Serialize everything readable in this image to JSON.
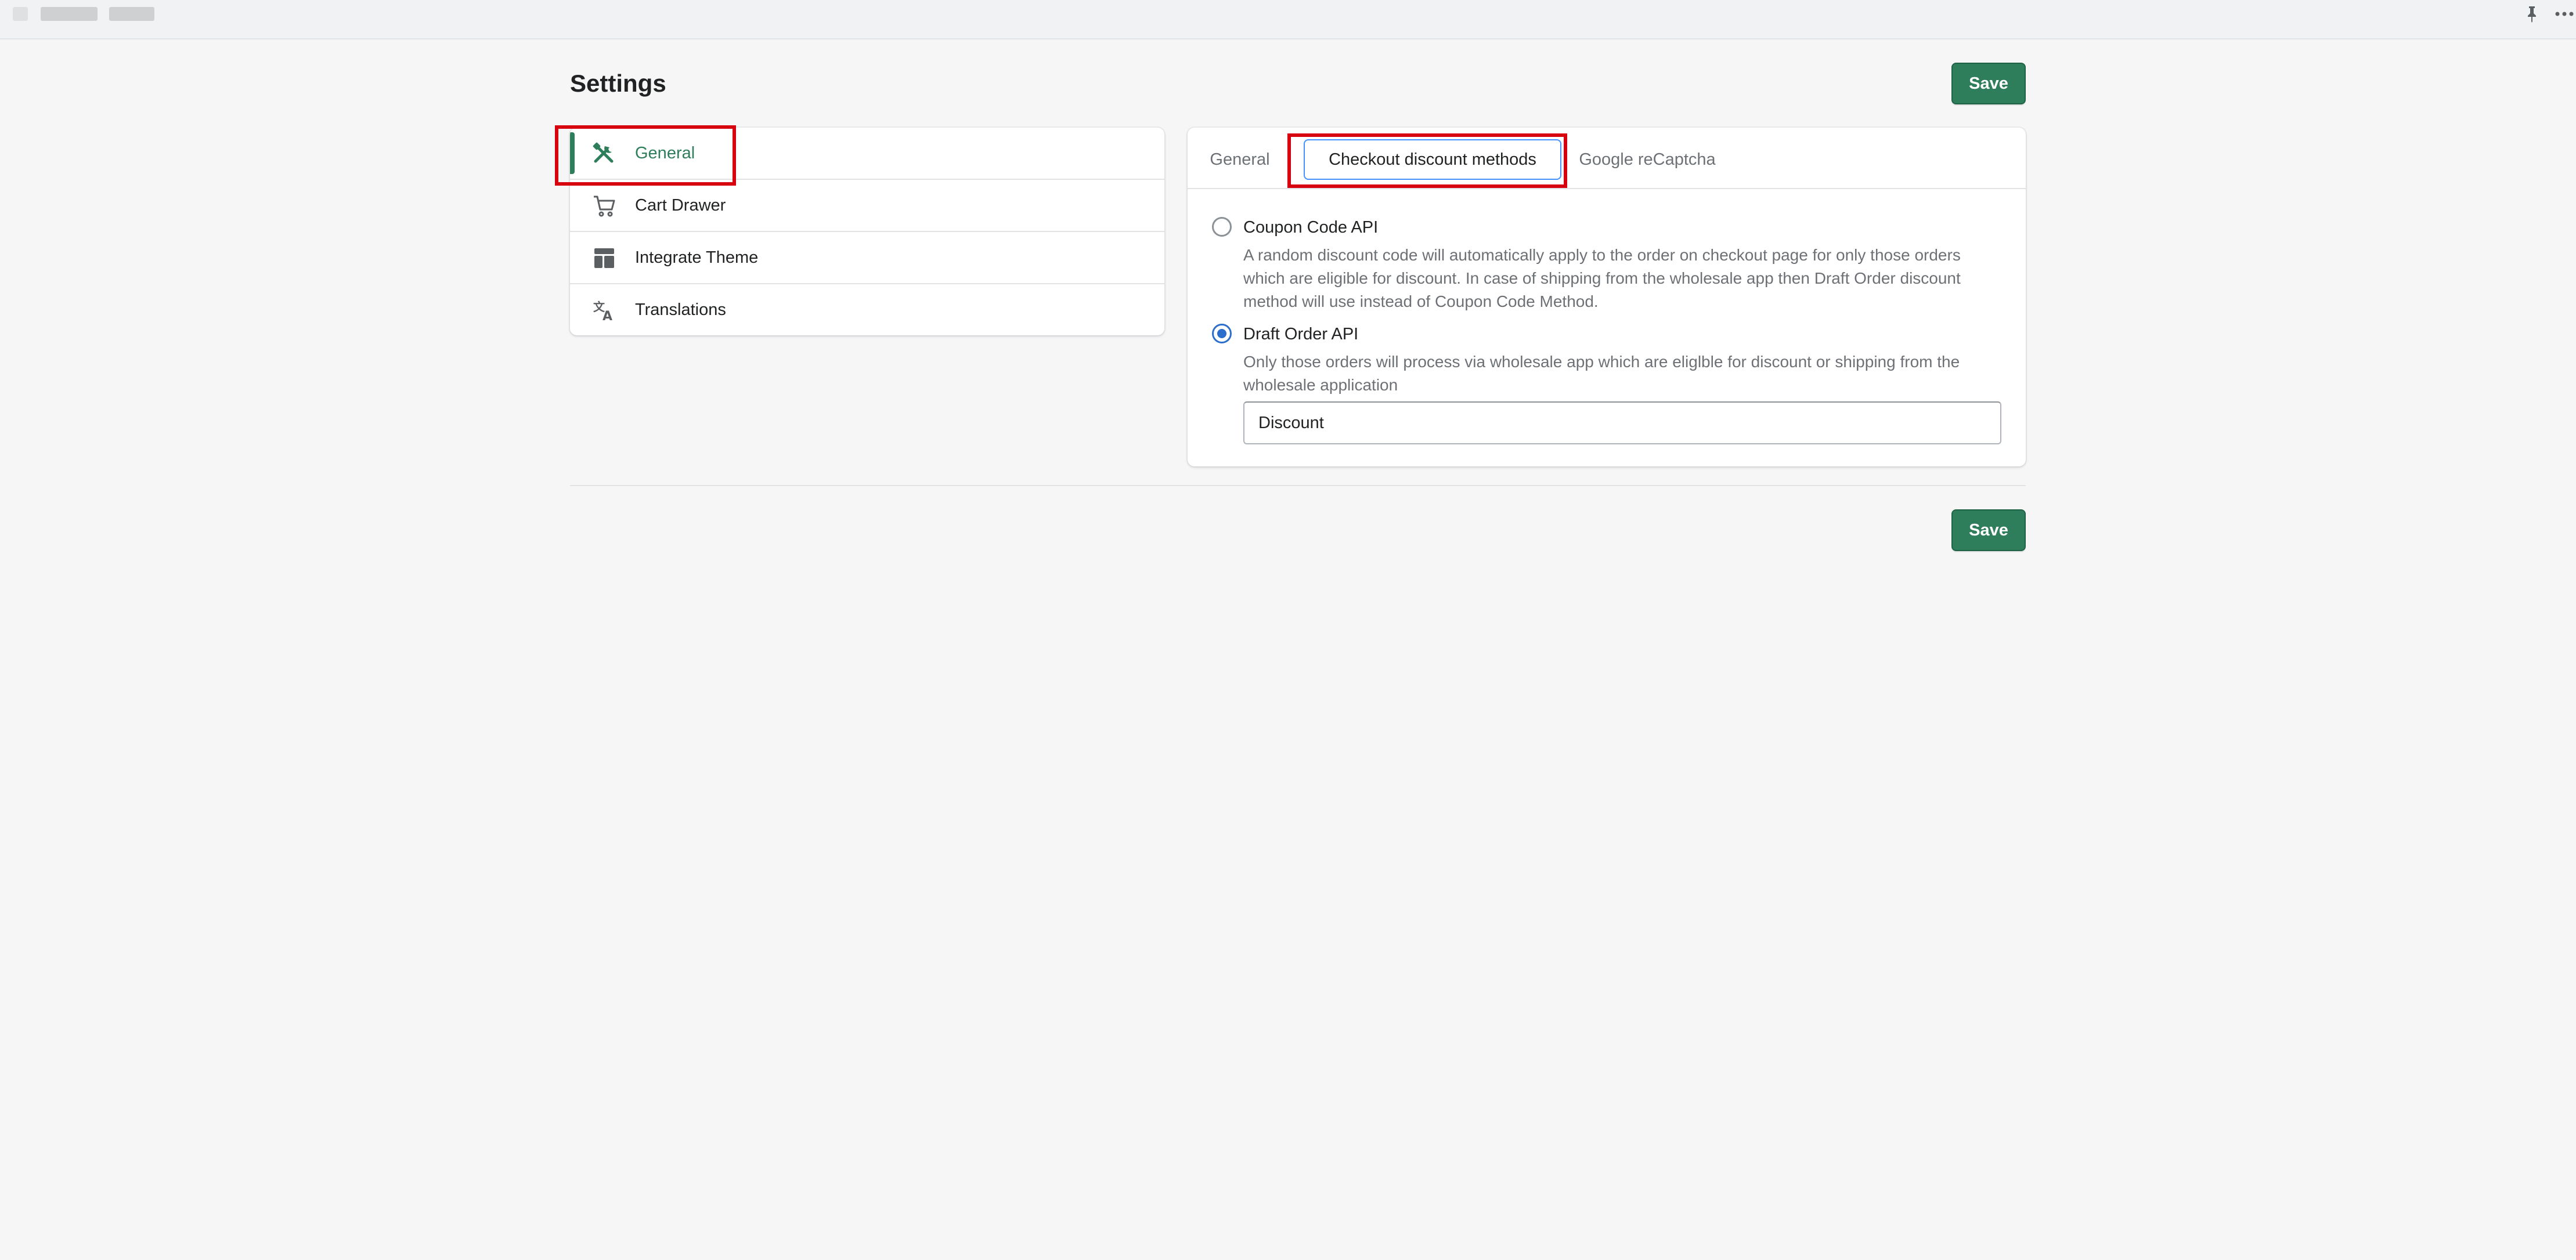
{
  "topbar": {
    "pin_icon": "pin-icon",
    "more_icon": "more-horizontal-icon"
  },
  "page": {
    "title": "Settings",
    "save_label": "Save",
    "save_bottom_label": "Save"
  },
  "nav": {
    "items": [
      {
        "label": "General",
        "icon": "tools-icon",
        "active": true
      },
      {
        "label": "Cart Drawer",
        "icon": "cart-icon",
        "active": false
      },
      {
        "label": "Integrate Theme",
        "icon": "layout-icon",
        "active": false
      },
      {
        "label": "Translations",
        "icon": "translate-icon",
        "active": false
      }
    ]
  },
  "tabs": {
    "items": [
      {
        "label": "General"
      },
      {
        "label": "Checkout discount methods",
        "selected": true
      },
      {
        "label": "Google reCaptcha"
      }
    ]
  },
  "options": {
    "coupon": {
      "label": "Coupon Code API",
      "help_lines": [
        "A random discount code will automatically apply to the order on checkout page for only those orders",
        "which are eligible for discount. In case of shipping from the wholesale app then Draft Order discount",
        "method will use instead of Coupon Code Method."
      ],
      "checked": false
    },
    "draft": {
      "label": "Draft Order API",
      "help_lines": [
        "Only those orders will process via wholesale app which are eliglble for discount or shipping from the",
        "wholesale application"
      ],
      "checked": true
    },
    "discount_input_value": "Discount"
  },
  "colors": {
    "primary": "#2e7d5b",
    "focus": "#458fff",
    "radio_checked": "#2c6ecb",
    "annotation": "#d7000f"
  }
}
